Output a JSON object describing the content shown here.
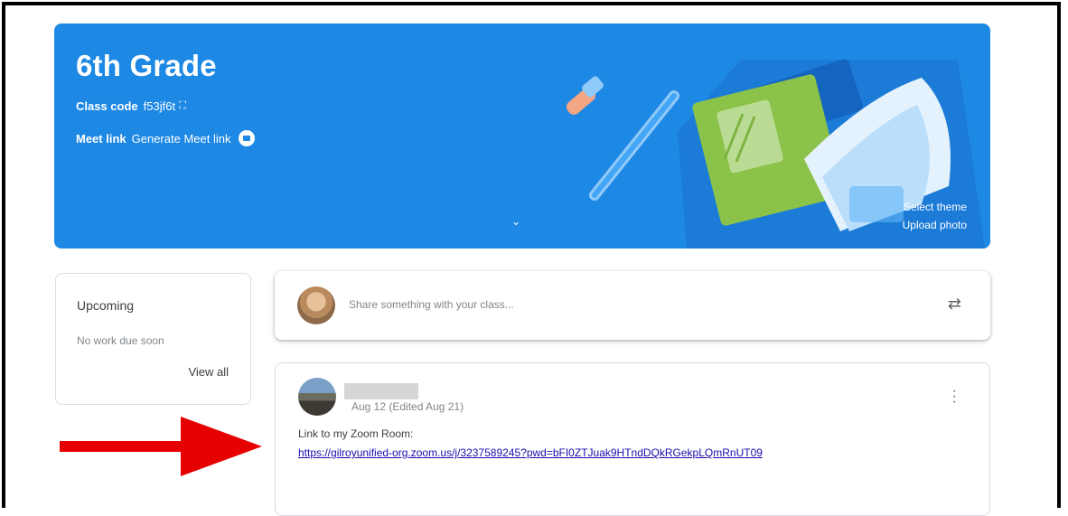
{
  "banner": {
    "title": "6th Grade",
    "class_code_label": "Class code",
    "class_code": "f53jf6t",
    "meet_label": "Meet link",
    "meet_action": "Generate Meet link",
    "select_theme": "Select theme",
    "upload_photo": "Upload photo",
    "color": "#1e88e5"
  },
  "upcoming": {
    "title": "Upcoming",
    "subtitle": "No work due soon",
    "view_all": "View all"
  },
  "share": {
    "placeholder": "Share something with your class..."
  },
  "post": {
    "date": "Aug 12 (Edited Aug 21)",
    "body": "Link to my Zoom Room:",
    "link": "https://gilroyunified-org.zoom.us/j/3237589245?pwd=bFI0ZTJuak9HTndDQkRGekpLQmRnUT09"
  },
  "annotation": {
    "arrow_color": "#e60000"
  }
}
